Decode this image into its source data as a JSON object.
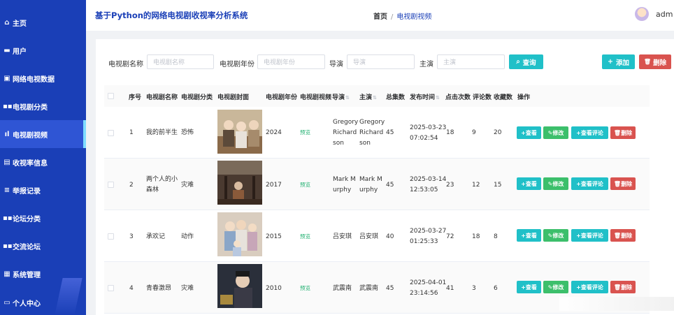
{
  "sidebar": {
    "items": [
      {
        "icon": "home-icon",
        "glyph": "⌂",
        "label": "主页"
      },
      {
        "icon": "user-icon",
        "glyph": "▬",
        "label": "用户"
      },
      {
        "icon": "data-icon",
        "glyph": "▣",
        "label": "网络电视数据"
      },
      {
        "icon": "category-icon",
        "glyph": "▪▪",
        "label": "电视剧分类"
      },
      {
        "icon": "bar-chart-icon",
        "glyph": "ıl",
        "label": "电视剧视频"
      },
      {
        "icon": "clipboard-icon",
        "glyph": "▤",
        "label": "收视率信息"
      },
      {
        "icon": "report-icon",
        "glyph": "≡",
        "label": "举报记录"
      },
      {
        "icon": "forum-category-icon",
        "glyph": "▪▪",
        "label": "论坛分类"
      },
      {
        "icon": "forum-icon",
        "glyph": "▪▪",
        "label": "交流论坛"
      },
      {
        "icon": "system-icon",
        "glyph": "▦",
        "label": "系统管理"
      },
      {
        "icon": "profile-icon",
        "glyph": "▭",
        "label": "个人中心"
      }
    ],
    "active_index": 4
  },
  "header": {
    "title": "基于Python的网络电视剧收视率分析系统",
    "breadcrumb_home": "首页",
    "breadcrumb_sep": "/",
    "breadcrumb_current": "电视剧视频",
    "user": "adm"
  },
  "filters": {
    "name_label": "电视剧名称",
    "name_placeholder": "电视剧名称",
    "year_label": "电视剧年份",
    "year_placeholder": "电视剧年份",
    "director_label": "导演",
    "director_placeholder": "导演",
    "actor_label": "主演",
    "actor_placeholder": "主演",
    "query_label": "查询",
    "add_label": "添加",
    "delete_label": "删除"
  },
  "table": {
    "headers": {
      "index": "序号",
      "name": "电视剧名称",
      "category": "电视剧分类",
      "cover": "电视剧封面",
      "year": "电视剧年份",
      "video": "电视剧视频",
      "director": "导演",
      "actor": "主演",
      "episodes": "总集数",
      "publish": "发布时间",
      "clicks": "点击次数",
      "comments": "评论数",
      "favorites": "收藏数",
      "ops": "操作"
    },
    "rows": [
      {
        "index": "1",
        "name_l1": "我的前半生",
        "name_l2": "",
        "category": "恐怖",
        "year": "2024",
        "video": "预览",
        "director_l1": "Gregory",
        "director_l2": "Richard",
        "director_l3": "son",
        "actor_l1": "Gregory",
        "actor_l2": "Richard",
        "actor_l3": "son",
        "episodes": "45",
        "date": "2025-03-23",
        "time": "07:02:54",
        "clicks": "18",
        "comments": "9",
        "favorites": "20"
      },
      {
        "index": "2",
        "name_l1": "两个人的小",
        "name_l2": "森林",
        "category": "灾难",
        "year": "2017",
        "video": "预览",
        "director_l1": "Mark M",
        "director_l2": "urphy",
        "director_l3": "",
        "actor_l1": "Mark M",
        "actor_l2": "urphy",
        "actor_l3": "",
        "episodes": "45",
        "date": "2025-03-14",
        "time": "12:53:05",
        "clicks": "23",
        "comments": "12",
        "favorites": "15"
      },
      {
        "index": "3",
        "name_l1": "承欢记",
        "name_l2": "",
        "category": "动作",
        "year": "2015",
        "video": "预览",
        "director_l1": "吕安琪",
        "director_l2": "",
        "director_l3": "",
        "actor_l1": "吕安琪",
        "actor_l2": "",
        "actor_l3": "",
        "episodes": "40",
        "date": "2025-03-27",
        "time": "01:25:33",
        "clicks": "72",
        "comments": "18",
        "favorites": "8"
      },
      {
        "index": "4",
        "name_l1": "青春激昂",
        "name_l2": "",
        "category": "灾难",
        "year": "2010",
        "video": "预览",
        "director_l1": "武震南",
        "director_l2": "",
        "director_l3": "",
        "actor_l1": "武震南",
        "actor_l2": "",
        "actor_l3": "",
        "episodes": "45",
        "date": "2025-04-01",
        "time": "23:14:56",
        "clicks": "41",
        "comments": "3",
        "favorites": "6"
      }
    ],
    "actions": {
      "view": "查看",
      "edit": "修改",
      "comments": "查看评论",
      "delete": "删除"
    }
  },
  "colors": {
    "sidebar": "#1a3fb7",
    "accent": "#20c0c8",
    "success": "#3cbf6b",
    "danger": "#d9534f"
  }
}
